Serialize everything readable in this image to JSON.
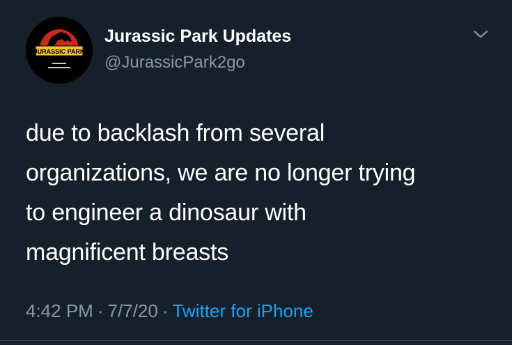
{
  "colors": {
    "background": "#15202b",
    "primary_text": "#ffffff",
    "secondary_text": "#8899a6",
    "link": "#1da1f2",
    "logo_red": "#c8281e"
  },
  "author": {
    "display_name": "Jurassic Park Updates",
    "handle": "@JurassicPark2go",
    "avatar_logo_text": "JURASSIC PARK",
    "avatar_icon": "jurassic-park-logo"
  },
  "tweet": {
    "text": "due to backlash from several\norganizations, we are no longer trying\nto engineer a dinosaur with\nmagnificent breasts",
    "time": "4:42 PM",
    "date": "7/7/20",
    "source": "Twitter for iPhone",
    "separator": "·"
  },
  "menu": {
    "icon": "chevron-down-icon"
  }
}
